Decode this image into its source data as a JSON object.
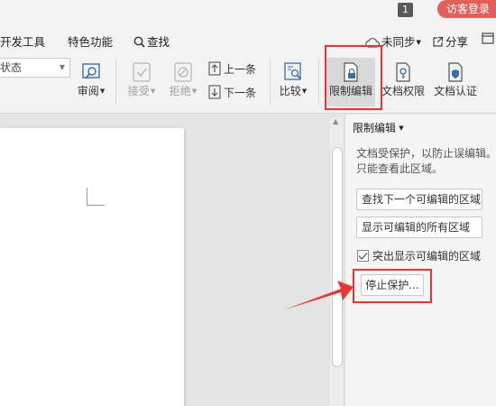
{
  "titlebar": {
    "page_badge": "1",
    "login_label": "访客登录"
  },
  "menubar": {
    "items": [
      {
        "label": "开发工具"
      },
      {
        "label": "特色功能"
      },
      {
        "label": "查找",
        "icon": "search-icon"
      }
    ],
    "sync_label": "未同步",
    "share_label": "分享"
  },
  "ribbon": {
    "status_select_value": "状态",
    "tools": {
      "review": "审阅",
      "accept": "接受",
      "reject": "拒绝",
      "prev": "上一条",
      "next": "下一条",
      "compare": "比较",
      "restrict_edit": "限制编辑",
      "doc_permission": "文档权限",
      "doc_certify": "文档认证"
    }
  },
  "panel": {
    "title": "限制编辑",
    "description": "文档受保护，以防止误编辑。只能查看此区域。",
    "find_next_btn": "查找下一个可编辑的区域",
    "show_all_btn": "显示可编辑的所有区域",
    "highlight_label": "突出显示可编辑的区域",
    "highlight_checked": true,
    "stop_protect_btn": "停止保护..."
  },
  "colors": {
    "accent_red": "#e33333",
    "login_bg": "#e35d59",
    "ribbon_bg": "#f3f3f3"
  }
}
